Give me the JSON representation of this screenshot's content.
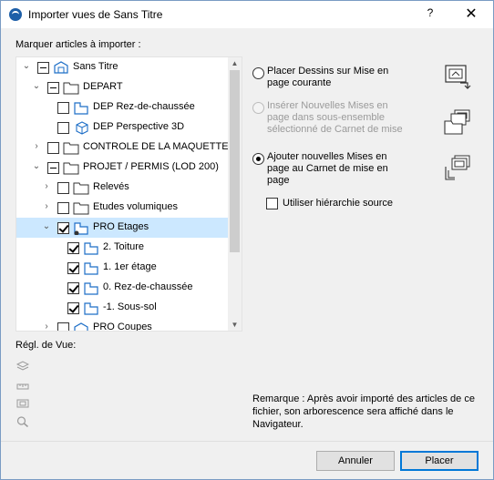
{
  "window": {
    "title": "Importer vues de Sans Titre",
    "help": "?",
    "close": "✕"
  },
  "tree": {
    "label": "Marquer articles à importer :",
    "nodes": [
      {
        "label": "Sans Titre"
      },
      {
        "label": "DEPART"
      },
      {
        "label": "DEP Rez-de-chaussée"
      },
      {
        "label": "DEP Perspective 3D"
      },
      {
        "label": "CONTROLE DE LA MAQUETTE"
      },
      {
        "label": "PROJET / PERMIS (LOD 200)"
      },
      {
        "label": "Relevés"
      },
      {
        "label": "Etudes volumiques"
      },
      {
        "label": "PRO Etages"
      },
      {
        "label": "2. Toiture"
      },
      {
        "label": "1. 1er étage"
      },
      {
        "label": "0. Rez-de-chaussée"
      },
      {
        "label": "-1. Sous-sol"
      },
      {
        "label": "PRO Coupes"
      }
    ]
  },
  "view_settings": {
    "label": "Régl. de Vue:"
  },
  "options": {
    "opt1": "Placer Dessins sur Mise en page courante",
    "opt2": "Insérer Nouvelles Mises en page dans sous-ensemble sélectionné de Carnet de mise en Page",
    "opt3": "Ajouter nouvelles Mises en page au Carnet de mise en page",
    "hierarchy": "Utiliser hiérarchie source"
  },
  "remark": "Remarque : Après avoir importé des articles de ce fichier, son arborescence sera affiché dans le Navigateur.",
  "buttons": {
    "cancel": "Annuler",
    "place": "Placer"
  }
}
